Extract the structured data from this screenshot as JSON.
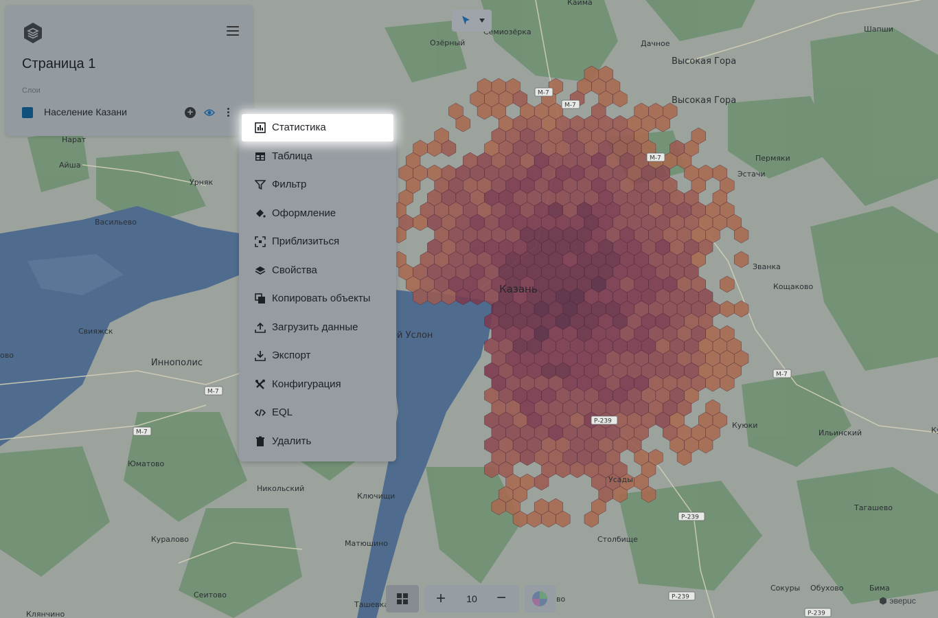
{
  "panel": {
    "page_title": "Страница 1",
    "layers_caption": "Слои",
    "layer": {
      "name": "Население Казани",
      "color": "#0f4f7c"
    }
  },
  "context_menu": {
    "items": [
      {
        "label": "Статистика",
        "icon": "statistics-icon",
        "active": true
      },
      {
        "label": "Таблица",
        "icon": "table-icon"
      },
      {
        "label": "Фильтр",
        "icon": "filter-icon"
      },
      {
        "label": "Оформление",
        "icon": "paint-bucket-icon"
      },
      {
        "label": "Приблизиться",
        "icon": "zoom-to-icon"
      },
      {
        "label": "Свойства",
        "icon": "layers-stack-icon"
      },
      {
        "label": "Копировать объекты",
        "icon": "copy-icon"
      },
      {
        "label": "Загрузить данные",
        "icon": "upload-icon"
      },
      {
        "label": "Экспорт",
        "icon": "download-icon"
      },
      {
        "label": "Конфигурация",
        "icon": "tools-icon"
      },
      {
        "label": "EQL",
        "icon": "code-icon"
      },
      {
        "label": "Удалить",
        "icon": "trash-icon"
      }
    ]
  },
  "map": {
    "zoom": "10",
    "brand": "эверuc",
    "labels": [
      {
        "text": "Кайма",
        "cls": ""
      },
      {
        "text": "Семиозёрка",
        "cls": ""
      },
      {
        "text": "Озёрный",
        "cls": ""
      },
      {
        "text": "Дачное",
        "cls": ""
      },
      {
        "text": "Высокая Гора",
        "cls": "big"
      },
      {
        "text": "Высокая Гора",
        "cls": "big"
      },
      {
        "text": "Шапши",
        "cls": ""
      },
      {
        "text": "Нарат",
        "cls": ""
      },
      {
        "text": "Айша",
        "cls": ""
      },
      {
        "text": "Урняк",
        "cls": ""
      },
      {
        "text": "Васильево",
        "cls": ""
      },
      {
        "text": "Пермяки",
        "cls": ""
      },
      {
        "text": "Эстачи",
        "cls": ""
      },
      {
        "text": "Званка",
        "cls": ""
      },
      {
        "text": "Кощаково",
        "cls": ""
      },
      {
        "text": "Казань",
        "cls": "city"
      },
      {
        "text": "Свияжск",
        "cls": ""
      },
      {
        "text": "Иннополис",
        "cls": "big"
      },
      {
        "text": "й Услон",
        "cls": "big"
      },
      {
        "text": "Куюки",
        "cls": ""
      },
      {
        "text": "Ильинский",
        "cls": ""
      },
      {
        "text": "Юматово",
        "cls": ""
      },
      {
        "text": "Никольский",
        "cls": ""
      },
      {
        "text": "Ключищи",
        "cls": ""
      },
      {
        "text": "Усады",
        "cls": ""
      },
      {
        "text": "Тагашево",
        "cls": ""
      },
      {
        "text": "Куралово",
        "cls": ""
      },
      {
        "text": "Матюшино",
        "cls": ""
      },
      {
        "text": "Столбище",
        "cls": ""
      },
      {
        "text": "Сеитово",
        "cls": ""
      },
      {
        "text": "Сокуры",
        "cls": ""
      },
      {
        "text": "Обухово",
        "cls": ""
      },
      {
        "text": "Бима",
        "cls": ""
      },
      {
        "text": "Ташевка",
        "cls": ""
      },
      {
        "text": "Клянчино",
        "cls": ""
      },
      {
        "text": "ово",
        "cls": ""
      },
      {
        "text": "Ку",
        "cls": ""
      },
      {
        "text": "во",
        "cls": ""
      }
    ],
    "shields": [
      "М-7",
      "М-7",
      "М-7",
      "М-7",
      "М-7",
      "М-7",
      "Р-239",
      "Р-239",
      "Р-239",
      "Р-239"
    ]
  }
}
